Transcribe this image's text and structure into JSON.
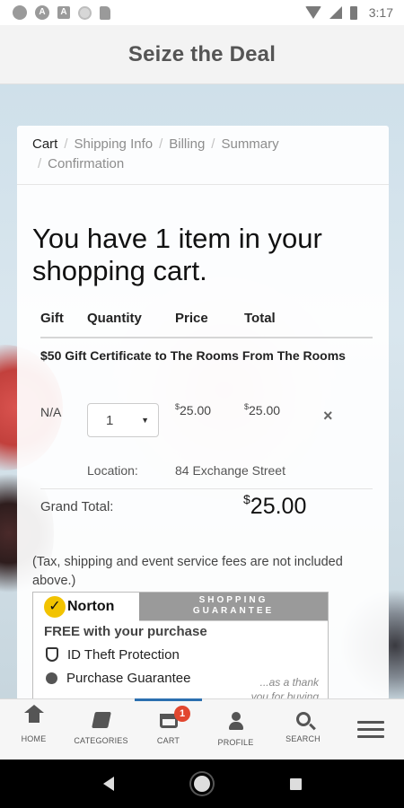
{
  "status_bar": {
    "time": "3:17",
    "icons": [
      "settings-icon",
      "a-circle-icon",
      "a-square-icon",
      "circle-icon",
      "sd-card-icon",
      "wifi-icon",
      "signal-icon",
      "battery-icon"
    ]
  },
  "header": {
    "title": "Seize the Deal"
  },
  "breadcrumb": {
    "items": [
      "Cart",
      "Shipping Info",
      "Billing",
      "Summary",
      "Confirmation"
    ],
    "active_index": 0
  },
  "cart": {
    "heading": "You have 1 item in your shopping cart.",
    "columns": [
      "Gift",
      "Quantity",
      "Price",
      "Total"
    ],
    "item": {
      "title": "$50 Gift Certificate to The Rooms From The Rooms",
      "gift": "N/A",
      "quantity": "1",
      "price_symbol": "$",
      "price": "25.00",
      "total_symbol": "$",
      "total": "25.00",
      "remove_label": "×",
      "location_label": "Location:",
      "location_value": "84 Exchange Street"
    },
    "grand_total_label": "Grand Total:",
    "grand_total_symbol": "$",
    "grand_total": "25.00",
    "tax_note": "(Tax, shipping and event service fees are not included above.)"
  },
  "norton": {
    "logo_text": "Norton",
    "band_line1": "SHOPPING",
    "band_line2": "GUARANTEE",
    "free_text": "FREE with your purchase",
    "features": [
      "ID Theft Protection",
      "Purchase Guarantee"
    ],
    "thank_text": "...as a thank",
    "thank_text2": "you for buying"
  },
  "bottom_nav": {
    "items": [
      {
        "label": "HOME",
        "icon": "home-icon"
      },
      {
        "label": "CATEGORIES",
        "icon": "book-icon"
      },
      {
        "label": "CART",
        "icon": "cart-icon",
        "badge": "1"
      },
      {
        "label": "PROFILE",
        "icon": "profile-icon"
      },
      {
        "label": "SEARCH",
        "icon": "search-icon"
      }
    ],
    "active_index": 2
  },
  "colors": {
    "accent": "#2b6fb0",
    "badge": "#e2472f",
    "norton_yellow": "#f2c300"
  }
}
